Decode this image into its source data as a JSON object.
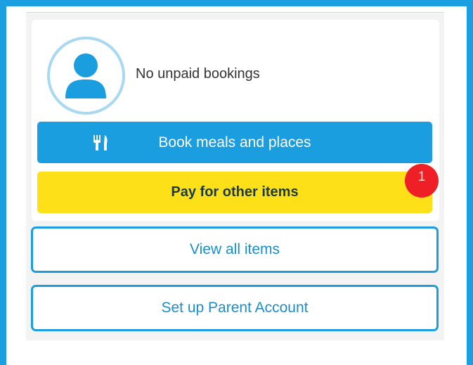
{
  "account": {
    "status_text": "No unpaid bookings"
  },
  "actions": {
    "book_label": "Book meals and places",
    "pay_label": "Pay for other items",
    "pay_badge_count": "1",
    "view_all_label": "View all items",
    "setup_label": "Set up Parent Account"
  },
  "icons": {
    "avatar": "person-icon",
    "book": "fork-knife-icon"
  },
  "colors": {
    "primary_blue": "#1a9ee0",
    "pay_yellow": "#fde018",
    "badge_red": "#ee1f25",
    "avatar_ring": "#a8d8f2"
  }
}
